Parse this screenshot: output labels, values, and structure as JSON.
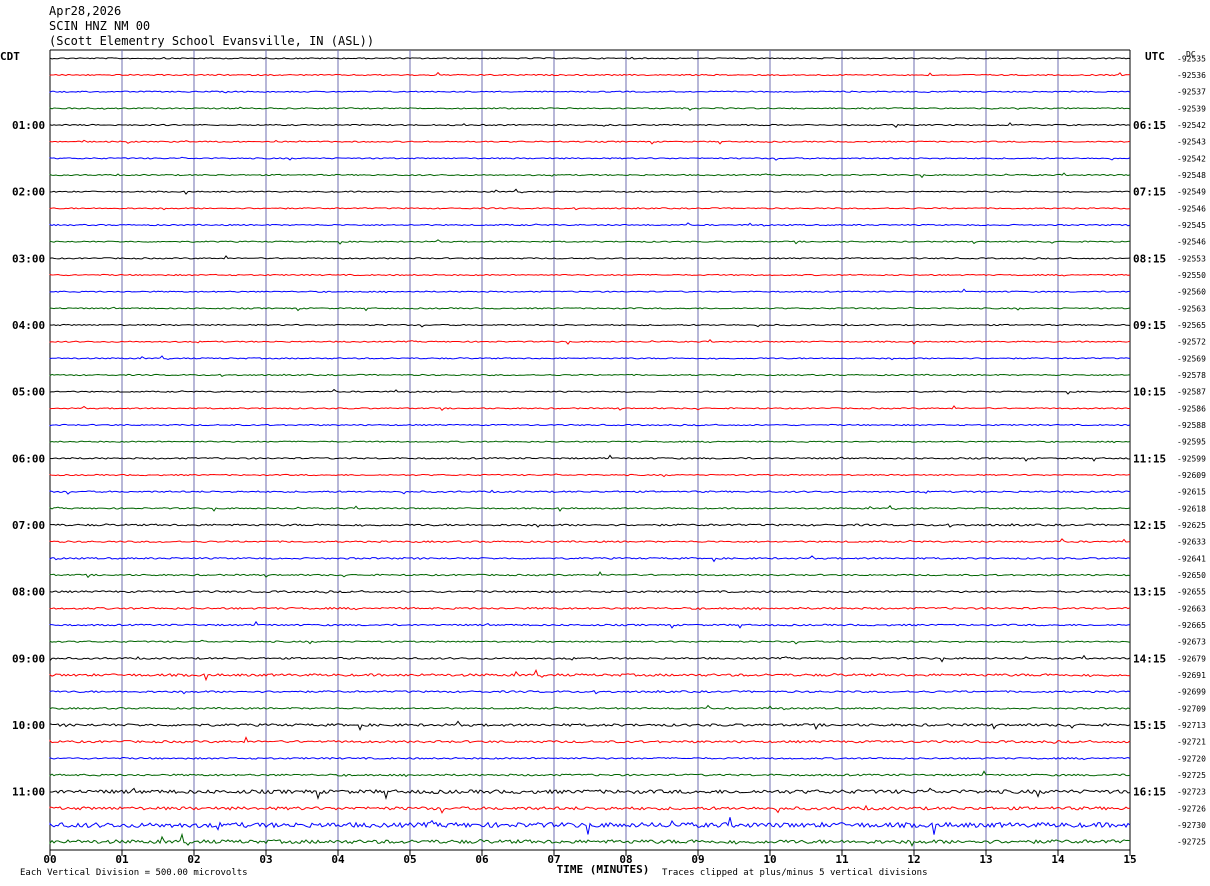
{
  "header": {
    "date": "Apr28,2026",
    "station": "SCIN HNZ NM 00",
    "location": "(Scott Elementry School Evansville, IN (ASL))"
  },
  "chart_data": {
    "type": "line",
    "title": "",
    "left_zone": "CDT",
    "right_zone": "UTC",
    "dc_label": "DC",
    "xlabel": "TIME (MINUTES)",
    "x_ticks": [
      "00",
      "01",
      "02",
      "03",
      "04",
      "05",
      "06",
      "07",
      "08",
      "09",
      "10",
      "11",
      "12",
      "13",
      "14",
      "15"
    ],
    "xlim": [
      0,
      15
    ],
    "left_hour_labels": [
      "01:00",
      "02:00",
      "03:00",
      "04:00",
      "05:00",
      "06:00",
      "07:00",
      "08:00",
      "09:00",
      "10:00",
      "11:00"
    ],
    "right_hour_labels": [
      "06:15",
      "07:15",
      "08:15",
      "09:15",
      "10:15",
      "11:15",
      "12:15",
      "13:15",
      "14:15",
      "15:15",
      "16:15"
    ],
    "trace_colors": [
      "#000000",
      "#ff0000",
      "#0000ff",
      "#006400"
    ],
    "dc_offsets": [
      "-92535",
      "-92536",
      "-92537",
      "-92539",
      "-92542",
      "-92543",
      "-92542",
      "-92548",
      "-92549",
      "-92546",
      "-92545",
      "-92546",
      "-92553",
      "-92550",
      "-92560",
      "-92563",
      "-92565",
      "-92572",
      "-92569",
      "-92578",
      "-92587",
      "-92586",
      "-92588",
      "-92595",
      "-92599",
      "-92609",
      "-92615",
      "-92618",
      "-92625",
      "-92633",
      "-92641",
      "-92650",
      "-92655",
      "-92663",
      "-92665",
      "-92673",
      "-92679",
      "-92691",
      "-92699",
      "-92709",
      "-92713",
      "-92721",
      "-92720",
      "-92725",
      "-92723",
      "-92726",
      "-92730",
      "-92725"
    ],
    "trace_noise_levels": [
      1,
      1,
      1,
      1,
      1,
      1,
      1,
      1,
      1,
      1,
      1,
      1,
      1,
      1,
      1,
      1,
      1,
      1,
      1,
      1,
      1,
      1,
      1,
      1,
      1.2,
      1,
      1.3,
      1.1,
      1.5,
      1.3,
      1.3,
      1.2,
      1.5,
      1.5,
      1.3,
      1.2,
      1.4,
      2,
      1.5,
      1.3,
      2,
      1.8,
      1.3,
      1.5,
      3,
      2.5,
      4,
      3
    ],
    "footer_left": "Each Vertical Division =  500.00 microvolts",
    "footer_right": "Traces clipped at plus/minus 5 vertical divisions"
  }
}
